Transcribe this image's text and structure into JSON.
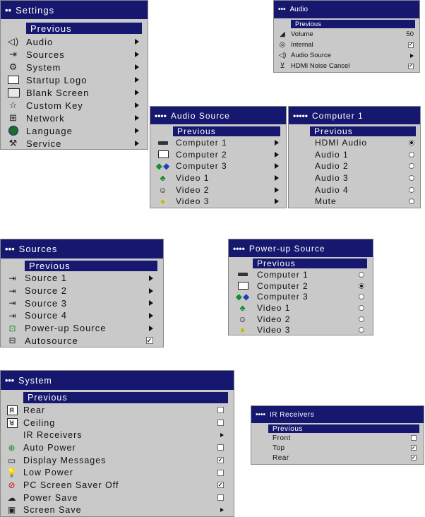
{
  "settings": {
    "title": "Settings",
    "dots": "••",
    "previous": "Previous",
    "items": [
      {
        "label": "Audio",
        "icon": "speaker-icon",
        "glyph": "🔊"
      },
      {
        "label": "Sources",
        "icon": "source-icon",
        "glyph": "⊕"
      },
      {
        "label": "System",
        "icon": "system-icon",
        "glyph": "⚙"
      },
      {
        "label": "Startup Logo",
        "icon": "logo-icon",
        "glyph": "▭"
      },
      {
        "label": "Blank Screen",
        "icon": "blank-screen-icon",
        "glyph": "□"
      },
      {
        "label": "Custom Key",
        "icon": "star-icon",
        "glyph": "☆"
      },
      {
        "label": "Network",
        "icon": "network-icon",
        "glyph": "⊞"
      },
      {
        "label": "Language",
        "icon": "globe-icon",
        "glyph": "●"
      },
      {
        "label": "Service",
        "icon": "wrench-icon",
        "glyph": "🔧"
      }
    ]
  },
  "audio": {
    "title": "Audio",
    "dots": "•••",
    "previous": "Previous",
    "volume_label": "Volume",
    "volume_value": "50",
    "internal_label": "Internal",
    "audio_source_label": "Audio Source",
    "hdmi_label": "HDMI Noise Cancel"
  },
  "audio_source": {
    "title": "Audio Source",
    "dots": "••••",
    "previous": "Previous",
    "items": [
      "Computer 1",
      "Computer 2",
      "Computer 3",
      "Video 1",
      "Video 2",
      "Video 3"
    ]
  },
  "computer1": {
    "title": "Computer 1",
    "dots": "•••••",
    "previous": "Previous",
    "items": [
      "HDMI Audio",
      "Audio 1",
      "Audio 2",
      "Audio 3",
      "Audio 4",
      "Mute"
    ],
    "selected": "HDMI Audio"
  },
  "sources": {
    "title": "Sources",
    "dots": "•••",
    "previous": "Previous",
    "items": [
      "Source 1",
      "Source 2",
      "Source 3",
      "Source 4",
      "Power-up Source"
    ],
    "autosource_label": "Autosource"
  },
  "power_up": {
    "title": "Power-up Source",
    "dots": "••••",
    "previous": "Previous",
    "items": [
      "Computer 1",
      "Computer 2",
      "Computer 3",
      "Video 1",
      "Video 2",
      "Video 3"
    ],
    "selected": "Computer 2"
  },
  "system": {
    "title": "System",
    "dots": "•••",
    "previous": "Previous",
    "rear": "Rear",
    "ceiling": "Ceiling",
    "ir_receivers": "IR Receivers",
    "auto_power": "Auto Power",
    "display_messages": "Display Messages",
    "low_power": "Low Power",
    "pc_screen_saver_off": "PC Screen Saver Off",
    "power_save": "Power Save",
    "screen_save": "Screen Save"
  },
  "ir": {
    "title": "IR Receivers",
    "dots": "••••",
    "previous": "Previous",
    "front": "Front",
    "top": "Top",
    "rear": "Rear"
  }
}
